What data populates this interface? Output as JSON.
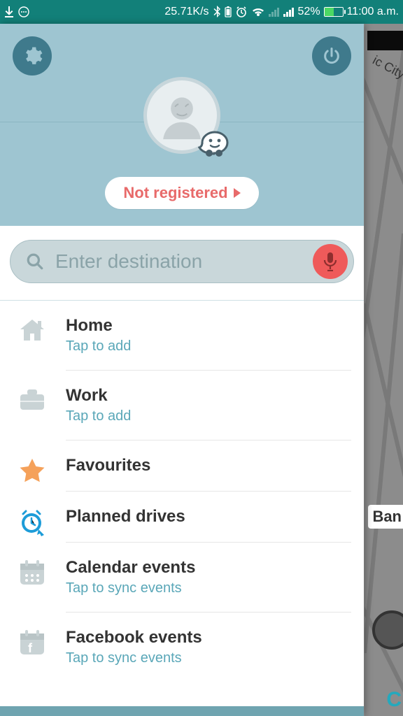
{
  "status": {
    "speed": "25.71K/s",
    "battery_pct": "52%",
    "time": "11:00 a.m."
  },
  "header": {
    "register_label": "Not registered"
  },
  "search": {
    "placeholder": "Enter destination"
  },
  "rows": {
    "home": {
      "title": "Home",
      "sub": "Tap to add"
    },
    "work": {
      "title": "Work",
      "sub": "Tap to add"
    },
    "fav": {
      "title": "Favourites"
    },
    "planned": {
      "title": "Planned drives"
    },
    "cal": {
      "title": "Calendar events",
      "sub": "Tap to sync events"
    },
    "fb": {
      "title": "Facebook events",
      "sub": "Tap to sync events"
    }
  },
  "map": {
    "city_fragment": "ic City",
    "label_fragment": "Ban",
    "corner": "C"
  }
}
